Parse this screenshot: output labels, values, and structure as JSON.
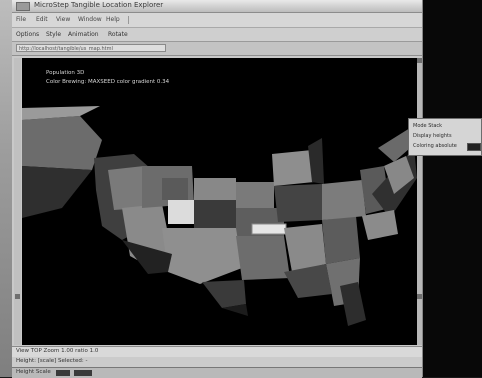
{
  "window": {
    "title": "MicroStep Tangible Location Explorer"
  },
  "toolbar": {
    "items": [
      "File",
      "Edit",
      "View",
      "Window",
      "Help"
    ]
  },
  "menubar": {
    "items": [
      "Options",
      "Style",
      "Animation",
      "Rotate"
    ]
  },
  "address": {
    "value": "http://localhost/tangible/us_map.html"
  },
  "canvas": {
    "info_line1": "Population 3D",
    "info_line2": "Color Brewing: MAXSEED color gradient 0.34"
  },
  "popup": {
    "row1": "Mode   Stack",
    "row2": "Display heights",
    "row3": "Coloring   absolute"
  },
  "status": {
    "line1": "View  TOP  Zoom 1.00 ratio 1.0",
    "line2": "Height: [scale]  Selected: -"
  },
  "taskbar": {
    "label": "Height   Scale"
  },
  "colors": {
    "canvas_bg": "#000000",
    "map_light": "#8f8f8f",
    "map_mid": "#6c6c6c",
    "map_dark": "#3c3c3c",
    "highlight": "#d9d9d9"
  }
}
